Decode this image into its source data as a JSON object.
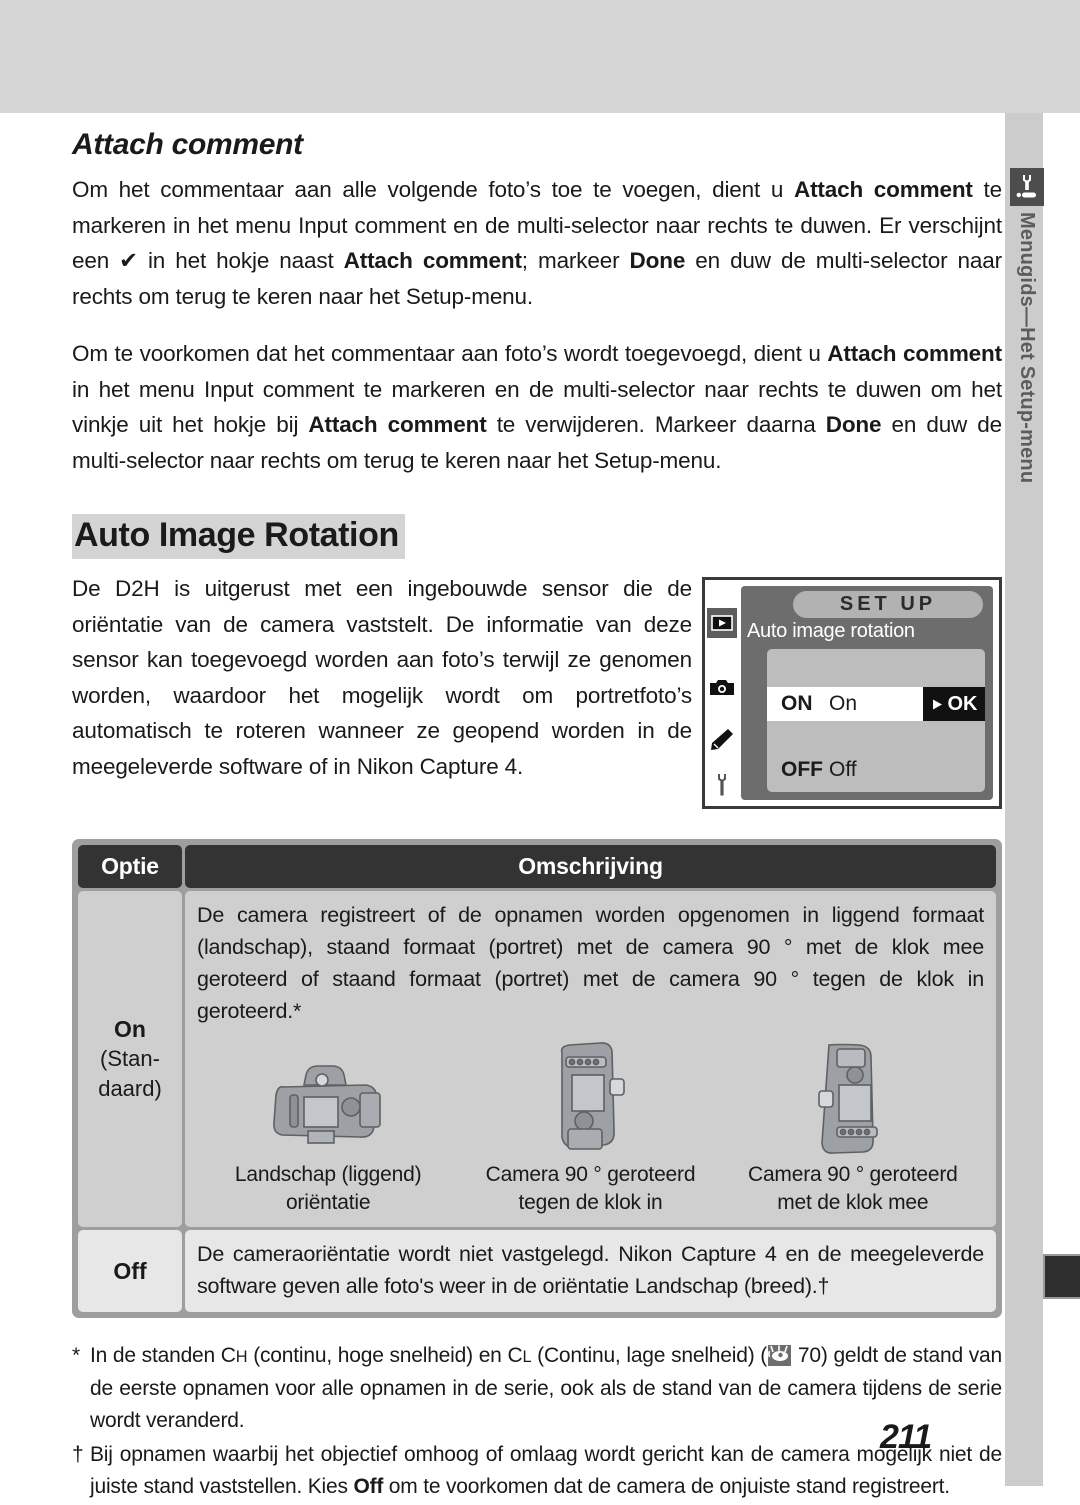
{
  "page": {
    "number": "211",
    "side_tab_label": "Menugids—Het Setup-menu",
    "side_tab_icon": "wrench-icon"
  },
  "sections": {
    "attach_comment": {
      "heading": "Attach comment",
      "paragraph_1_html": "Om het commentaar aan alle volgende foto’s toe te voegen, dient u <b>Attach comment</b> te markeren in het menu Input comment en de multi-selector naar rechts te duwen. Er verschijnt een ✔ in het hokje naast <b>Attach comment</b>; markeer <b>Done</b> en duw de multi-selector naar rechts om terug te keren naar het Setup-menu.",
      "paragraph_2_html": "Om te voorkomen dat het commentaar aan foto’s wordt toegevoegd, dient u <b>Attach comment</b> in het menu Input comment te markeren en de multi-selector naar rechts te duwen om het vinkje uit het hokje bij <b>Attach comment</b> te verwijderen. Markeer daarna <b>Done</b> en duw de multi-selector naar rechts om terug te keren naar het Setup-menu."
    },
    "auto_image_rotation": {
      "heading": "Auto Image Rotation",
      "intro": "De D2H is uitgerust met een ingebouwde sensor die de oriëntatie van de camera vaststelt. De informatie van deze sensor kan toegevoegd worden aan foto’s terwijl ze genomen worden, waardoor het mogelijk wordt om portretfoto’s automatisch te roteren wanneer ze geopend worden in de meegeleverde software of in Nikon Capture 4."
    }
  },
  "lcd": {
    "title": "SET UP",
    "menu_name": "Auto image rotation",
    "rows": [
      {
        "code": "ON",
        "name": "On",
        "highlighted": true,
        "ok_label": "OK"
      },
      {
        "code": "OFF",
        "name": "Off",
        "highlighted": false
      }
    ],
    "sidebar_icons": [
      "playback-icon",
      "camera-icon",
      "pencil-icon",
      "wrench-icon"
    ]
  },
  "table": {
    "headers": {
      "option": "Optie",
      "description": "Omschrijving"
    },
    "rows": [
      {
        "option_label": "On",
        "option_note": "(Stan-\ndaard)",
        "description": "De camera registreert of de opnamen worden opgenomen in liggend formaat (landschap), staand formaat (portret) met de camera 90 ° met de klok mee geroteerd of staand formaat (portret) met de camera 90 ° tegen de klok in geroteerd.*",
        "figures": [
          {
            "caption": "Landschap (liggend)\noriëntatie",
            "orientation": "landscape"
          },
          {
            "caption": "Camera 90 ° geroteerd\ntegen de klok in",
            "orientation": "ccw"
          },
          {
            "caption": "Camera 90 ° geroteerd\nmet de klok mee",
            "orientation": "cw"
          }
        ]
      },
      {
        "option_label": "Off",
        "option_note": "",
        "description": "De cameraoriëntatie wordt niet vastgelegd. Nikon Capture 4 en de meegeleverde software geven alle foto's weer in de oriëntatie Landschap (breed).†",
        "figures": []
      }
    ]
  },
  "footnotes": [
    {
      "mark": "*",
      "html": "In de standen C<span class=\"sc\">H</span> (continu, hoge snelheid) en C<span class=\"sc\">L</span> (Continu, lage snelheid) (<span class=\"ref-icon\" data-name=\"reference-eye-icon\"><svg width=\"23\" height=\"21\" viewBox=\"0 0 23 21\"><g stroke=\"#ffffff\" stroke-width=\"1.6\" fill=\"none\"><path d=\"M5 7 L3 1\"/><path d=\"M11 6 L11 0.5\"/><path d=\"M17 7 L19 1\"/><path d=\"M1.5 12 a6 7 0 0 1 0 -6\"/></g><ellipse cx=\"12\" cy=\"11\" rx=\"8\" ry=\"5\" fill=\"#ffffff\"/><circle cx=\"12.5\" cy=\"10\" r=\"2.2\" fill=\"#6e6e6e\"/></svg></span> 70) geldt de stand van de eerste opnamen voor alle opnamen in de serie, ook als de stand van de camera tijdens de serie wordt veranderd."
    },
    {
      "mark": "†",
      "html": "Bij opnamen waarbij het objectief omhoog of omlaag wordt gericht kan de camera mogelijk niet de juiste stand vaststellen. Kies <b>Off</b> om te voorkomen dat de camera de onjuiste stand registreert."
    }
  ],
  "colors": {
    "page_band": "#d6d6d6",
    "side_band": "#cccccc",
    "table_header": "#333333",
    "table_cell": "#cfcfcf",
    "table_cell_alt": "#e7e7e7",
    "heading_highlight": "#d4d4d4",
    "lcd_body": "#6d6d6d",
    "lcd_panel": "#bdbdbd"
  }
}
